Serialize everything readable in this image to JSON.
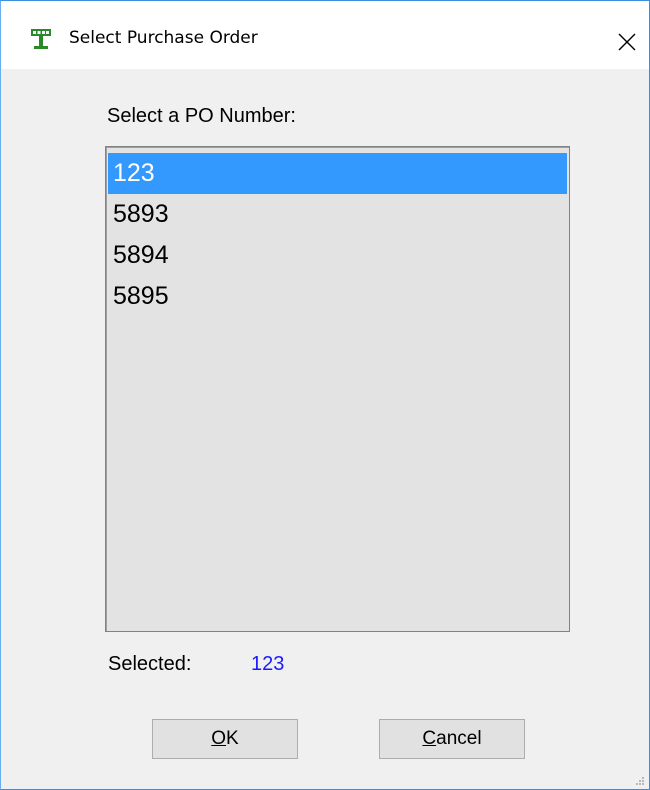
{
  "window": {
    "title": "Select Purchase Order",
    "title_icon": "cash-register-icon",
    "close_glyph": "✕",
    "accent_color": "#3399ff"
  },
  "form": {
    "prompt_label": "Select a PO Number:",
    "po_numbers": [
      "123",
      "5893",
      "5894",
      "5895"
    ],
    "selected_index": 0,
    "selected_label": "Selected:",
    "selected_value": "123",
    "selected_value_color": "#1a1aff"
  },
  "buttons": {
    "ok_accel": "O",
    "ok_rest": "K",
    "cancel_accel": "C",
    "cancel_rest": "ancel"
  }
}
